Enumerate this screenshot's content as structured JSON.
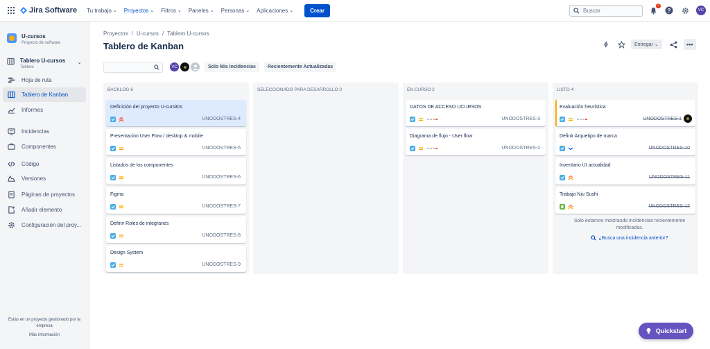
{
  "topnav": {
    "app_name": "Jira Software",
    "menu": [
      {
        "label": "Tu trabajo",
        "active": false
      },
      {
        "label": "Proyectos",
        "active": true
      },
      {
        "label": "Filtros",
        "active": false
      },
      {
        "label": "Paneles",
        "active": false
      },
      {
        "label": "Personas",
        "active": false
      },
      {
        "label": "Aplicaciones",
        "active": false
      }
    ],
    "create_label": "Crear",
    "search_placeholder": "Buscar",
    "notification_count": "2",
    "user_initials": "VC"
  },
  "sidebar": {
    "project_name": "U-cursos",
    "project_type": "Proyecto de software",
    "board_name": "Tablero U-cursos",
    "board_type": "Tablero",
    "items": [
      {
        "label": "Hoja de ruta",
        "icon": "roadmap-icon",
        "active": false
      },
      {
        "label": "Tablero de Kanban",
        "icon": "board-icon",
        "active": true
      },
      {
        "label": "Informes",
        "icon": "reports-icon",
        "active": false
      },
      {
        "label": "Incidencias",
        "icon": "issues-icon",
        "active": false
      },
      {
        "label": "Componentes",
        "icon": "components-icon",
        "active": false
      },
      {
        "label": "Código",
        "icon": "code-icon",
        "active": false
      },
      {
        "label": "Versiones",
        "icon": "releases-icon",
        "active": false
      },
      {
        "label": "Páginas de proyectos",
        "icon": "pages-icon",
        "active": false
      },
      {
        "label": "Añadir elemento",
        "icon": "add-item-icon",
        "active": false
      },
      {
        "label": "Configuración del proy...",
        "icon": "settings-icon",
        "active": false
      }
    ],
    "footer_text": "Estás en un proyecto gestionado por la empresa",
    "footer_link": "Más información"
  },
  "main": {
    "breadcrumb": [
      "Proyectos",
      "/",
      "U-cursos",
      "/",
      "Tablero U-cursos"
    ],
    "title": "Tablero de Kanban",
    "release_label": "Entregar",
    "avatars": [
      "VC",
      "",
      ""
    ],
    "filters": {
      "only_mine": "Solo Mis Incidencias",
      "recently_updated": "Recientemente Actualizadas"
    }
  },
  "board": {
    "columns": [
      {
        "title": "BACKLOG 6",
        "cards": [
          {
            "title": "Definición del proyecto U-cursitos",
            "key": "UNODOSTRES-4",
            "priority": "highest",
            "selected": true,
            "epic": false,
            "done": false
          },
          {
            "title": "Presentación User Flow / desktop & mobile",
            "key": "UNODOSTRES-5",
            "priority": "medium",
            "selected": false,
            "epic": false,
            "done": false
          },
          {
            "title": "Listados de los componentes",
            "key": "UNODOSTRES-6",
            "priority": "medium",
            "selected": false,
            "epic": false,
            "done": false
          },
          {
            "title": "Figma",
            "key": "UNODOSTRES-7",
            "priority": "medium",
            "selected": false,
            "epic": false,
            "done": false
          },
          {
            "title": "Definir Roles de integranes",
            "key": "UNODOSTRES-8",
            "priority": "medium",
            "selected": false,
            "epic": false,
            "done": false
          },
          {
            "title": "Design System",
            "key": "UNODOSTRES-9",
            "priority": "medium",
            "selected": false,
            "epic": false,
            "done": false
          }
        ]
      },
      {
        "title": "SELECCIONADO PARA DESARROLLO 0",
        "cards": []
      },
      {
        "title": "EN CURSO 2",
        "cards": [
          {
            "title": "DATOS DE ACCESO UCURSOS",
            "key": "UNODOSTRES-3",
            "priority": "medium",
            "selected": false,
            "epic": true,
            "done": false
          },
          {
            "title": "Diagrama de flujo - User flow",
            "key": "UNODOSTRES-2",
            "priority": "medium",
            "selected": false,
            "epic": true,
            "done": false
          }
        ]
      },
      {
        "title": "LISTO 4",
        "cards": [
          {
            "title": "Evaluación heurística",
            "key": "UNODOSTRES-1",
            "priority": "medium",
            "selected": false,
            "epic": true,
            "done": true,
            "edge": "#ffab00",
            "avatar": true
          },
          {
            "title": "Definir Arquetipo de marca",
            "key": "UNODOSTRES-10",
            "priority": "low",
            "selected": false,
            "epic": false,
            "done": true
          },
          {
            "title": "Inventario UI actualidad",
            "key": "UNODOSTRES-11",
            "priority": "high",
            "selected": false,
            "epic": false,
            "done": true
          },
          {
            "title": "Trabajo Niu Sushi",
            "key": "UNODOSTRES-12",
            "priority": "high",
            "selected": false,
            "epic": false,
            "done": true,
            "story": true
          }
        ]
      }
    ],
    "done_note": "Solo estamos mostrando incidencias recientemente modificadas.",
    "done_link": "¿Busca una incidencia anterior?"
  },
  "quickstart_label": "Quickstart",
  "colors": {
    "brand": "#0052cc",
    "quickstart": "#6554c0",
    "task": "#4bade8",
    "story": "#63ba3c",
    "priority_medium": "#ffab00",
    "priority_high": "#ff7452",
    "priority_low": "#0065ff"
  }
}
